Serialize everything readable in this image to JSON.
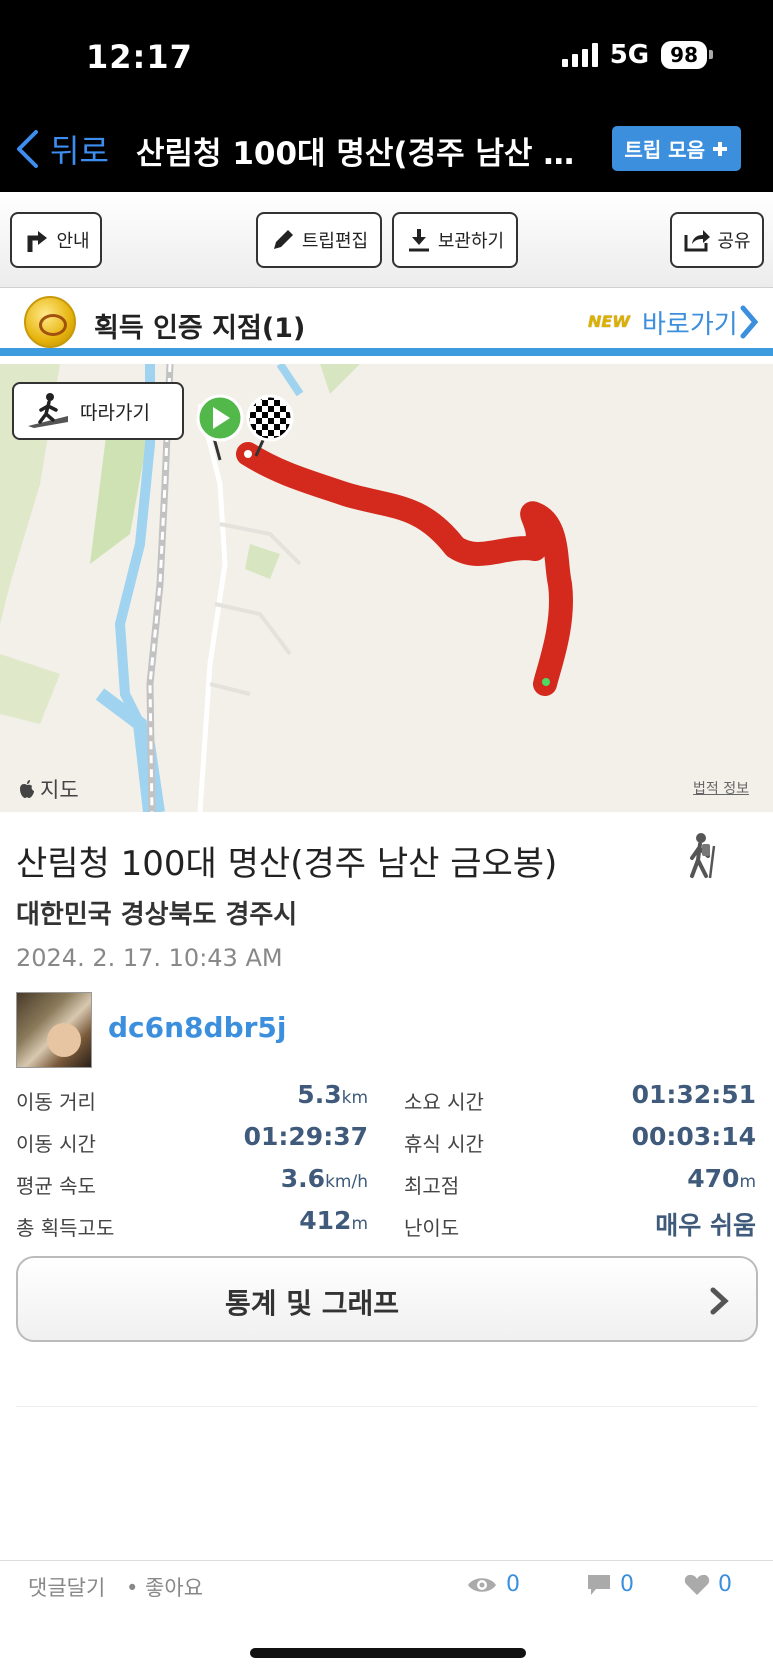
{
  "status_bar": {
    "time": "12:17",
    "network": "5G",
    "battery": "98"
  },
  "nav": {
    "back_label": "뒤로",
    "title": "산림청 100대 명산(경주 남산 금오봉)",
    "trip_collection": "트립 모음"
  },
  "toolbar": {
    "guide": "안내",
    "edit": "트립편집",
    "save": "보관하기",
    "share": "공유"
  },
  "certification": {
    "title": "획득 인증 지점(1)",
    "badge": "NEW",
    "link": "바로가기"
  },
  "map": {
    "follow": "따라가기",
    "brand": "지도",
    "legal": "법적 정보"
  },
  "trip": {
    "name": "산림청 100대 명산(경주 남산 금오봉)",
    "region": "대한민국 경상북도 경주시",
    "date": "2024. 2. 17. 10:43 AM",
    "user": "dc6n8dbr5j"
  },
  "stats": [
    {
      "label": "이동 거리",
      "value": "5.3",
      "unit": "km"
    },
    {
      "label": "소요 시간",
      "value": "01:32:51",
      "unit": ""
    },
    {
      "label": "이동 시간",
      "value": "01:29:37",
      "unit": ""
    },
    {
      "label": "휴식 시간",
      "value": "00:03:14",
      "unit": ""
    },
    {
      "label": "평균 속도",
      "value": "3.6",
      "unit": "km/h"
    },
    {
      "label": "최고점",
      "value": "470",
      "unit": "m"
    },
    {
      "label": "총 획득고도",
      "value": "412",
      "unit": "m"
    },
    {
      "label": "난이도",
      "value": "매우 쉬움",
      "unit": ""
    }
  ],
  "graph_button": "통계 및 그래프",
  "bottom": {
    "comment": "댓글달기",
    "like": "• 좋아요",
    "views": "0",
    "comments": "0",
    "likes": "0"
  },
  "colors": {
    "accent": "#3b8fdd",
    "track": "#d42a1e",
    "cert_bar": "#3d9be0"
  }
}
